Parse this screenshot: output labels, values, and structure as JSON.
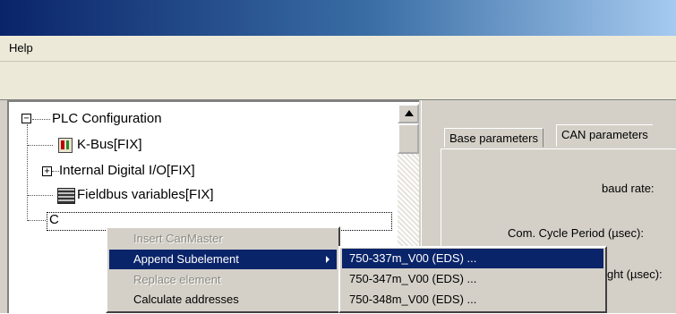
{
  "menubar": {
    "help": "Help"
  },
  "tree": {
    "root": "PLC Configuration",
    "items": [
      "K-Bus[FIX]",
      "Internal Digital I/O[FIX]",
      "Fieldbus variables[FIX]",
      "C"
    ],
    "root_expander": "−",
    "digital_expander": "+"
  },
  "tabs": [
    "Base parameters",
    "CAN parameters"
  ],
  "parameters": {
    "baud_rate": "baud rate:",
    "com_cycle": "Com. Cycle Period (µsec):",
    "partial_label": "ght (µsec):"
  },
  "context_menu": {
    "items": [
      {
        "label": "Insert CanMaster",
        "enabled": false
      },
      {
        "label": "Append Subelement",
        "enabled": true,
        "highlighted": true,
        "submenu": true
      },
      {
        "label": "Replace element",
        "enabled": false
      },
      {
        "label": "Calculate addresses",
        "enabled": true
      }
    ]
  },
  "submenu": {
    "items": [
      "750-337m_V00 (EDS) ...",
      "750-347m_V00 (EDS) ...",
      "750-348m_V00 (EDS) ..."
    ]
  }
}
